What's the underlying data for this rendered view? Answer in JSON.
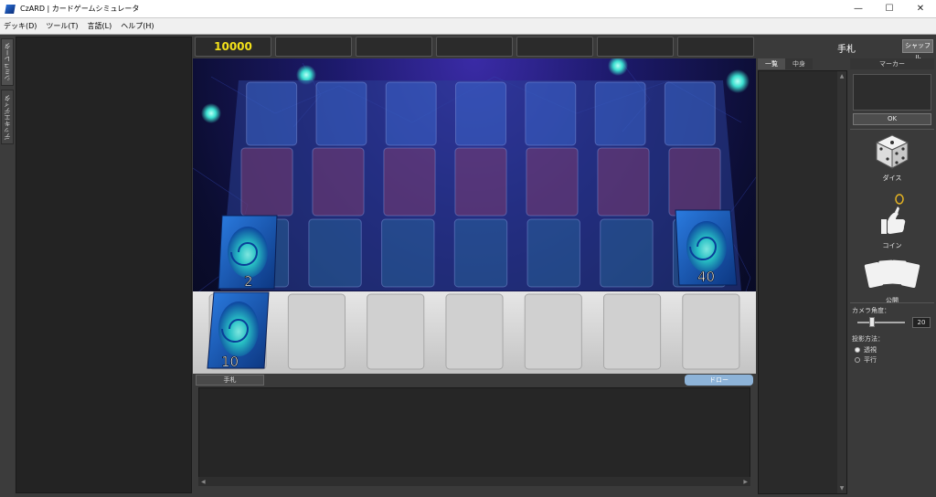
{
  "window": {
    "title": "CzARD | カードゲームシミュレータ",
    "controls": [
      "—",
      "☐",
      "✕"
    ]
  },
  "menu": [
    "デッキ(D)",
    "ツール(T)",
    "言語(L)",
    "ヘルプ(H)"
  ],
  "left_tabs": {
    "simulator": "シミュレータ",
    "deck_editor": "デッキエディタ"
  },
  "score": {
    "main": "10000",
    "others": [
      "",
      "",
      "",
      "",
      "",
      ""
    ]
  },
  "board": {
    "deck_counts": {
      "left_upper": "2",
      "right_upper": "40",
      "left_lower": "10"
    },
    "colors": {
      "card_blue": "#1a5fb4",
      "swirl": "#2ad3c8",
      "orb": "#3ce0d0",
      "hand_zone": "#d6d6d6"
    }
  },
  "hand_bar": {
    "tab_label": "手札",
    "draw_label": "ドロー"
  },
  "right_panel": {
    "title": "手札",
    "shuffle_label": "シャッフル",
    "tabs": [
      "一覧",
      "中身"
    ],
    "marker_label": "マーカー",
    "ok_label": "OK",
    "tools": {
      "dice": "ダイス",
      "coin": "コイン",
      "reveal": "公開"
    },
    "camera_angle_label": "カメラ角度：",
    "camera_angle_value": "20",
    "camera_angle_fraction": 0.2,
    "projection_label": "投影方法：",
    "projection_options": [
      "透視",
      "平行"
    ],
    "projection_selected": "透視"
  }
}
